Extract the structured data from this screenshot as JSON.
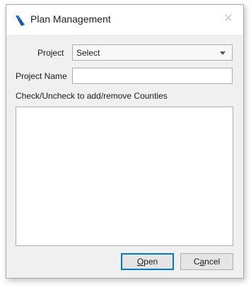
{
  "window": {
    "title": "Plan Management",
    "close_glyph": "✕",
    "icon": "app-logo-icon",
    "accent_color": "#1c5fa8"
  },
  "form": {
    "project_label": "Project",
    "project_selected": "Select",
    "project_name_label": "Project Name",
    "project_name_value": "",
    "counties_instruction": "Check/Uncheck to add/remove Counties",
    "counties": []
  },
  "buttons": {
    "open": {
      "mnemonic": "O",
      "rest": "pen"
    },
    "cancel": {
      "pre": "C",
      "mnemonic": "a",
      "rest": "ncel"
    }
  }
}
